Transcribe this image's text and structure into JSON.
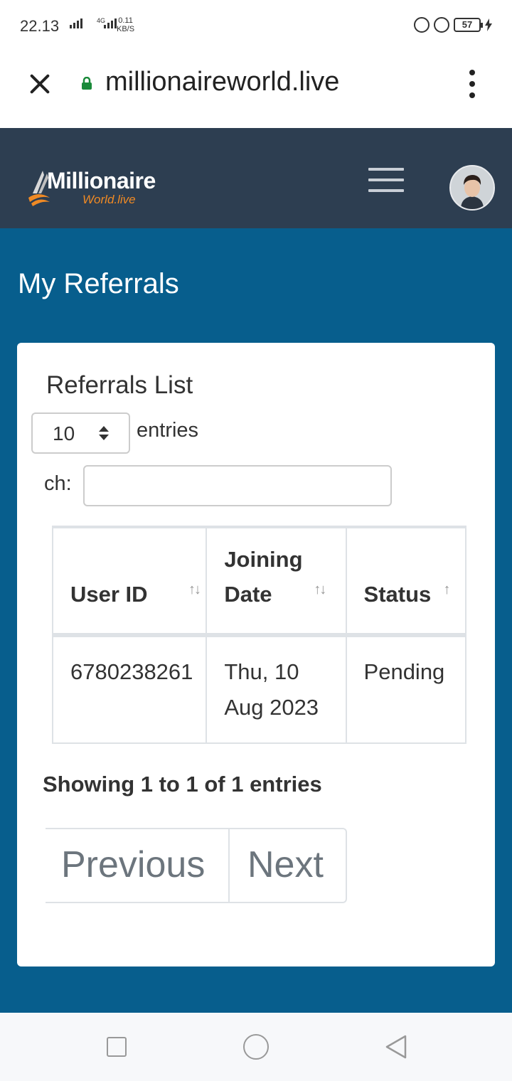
{
  "status_bar": {
    "time": "22.13",
    "network": "4G",
    "speed_value": "0.11",
    "speed_unit": "KB/S",
    "battery": "57"
  },
  "browser": {
    "url": "millionaireworld.live"
  },
  "header": {
    "logo_main": "Millionaire",
    "logo_sub": "World.live"
  },
  "page": {
    "title": "My Referrals"
  },
  "card": {
    "title": "Referrals List",
    "length_value": "10",
    "entries_label": "entries",
    "search_label": "ch:",
    "search_value": ""
  },
  "table": {
    "columns": [
      {
        "label": "User ID",
        "sort_icon": "↑↓"
      },
      {
        "label": "Joining Date",
        "sort_icon": "↑↓"
      },
      {
        "label": "Status",
        "sort_icon": "↑"
      }
    ],
    "rows": [
      {
        "user_id": "6780238261",
        "joining_date": "Thu, 10 Aug 2023",
        "status": "Pending"
      }
    ]
  },
  "footer": {
    "info": "Showing 1 to 1 of 1 entries",
    "prev_label": "Previous",
    "next_label": "Next"
  },
  "icons": {
    "close": "close-icon",
    "lock": "lock-icon",
    "menu": "more-vert-icon",
    "hamburger": "hamburger-icon",
    "avatar": "avatar"
  },
  "colors": {
    "header_bg": "#2d3e51",
    "main_bg": "#075e8d",
    "logo_accent": "#f08a24",
    "lock": "#1a8a3a"
  }
}
